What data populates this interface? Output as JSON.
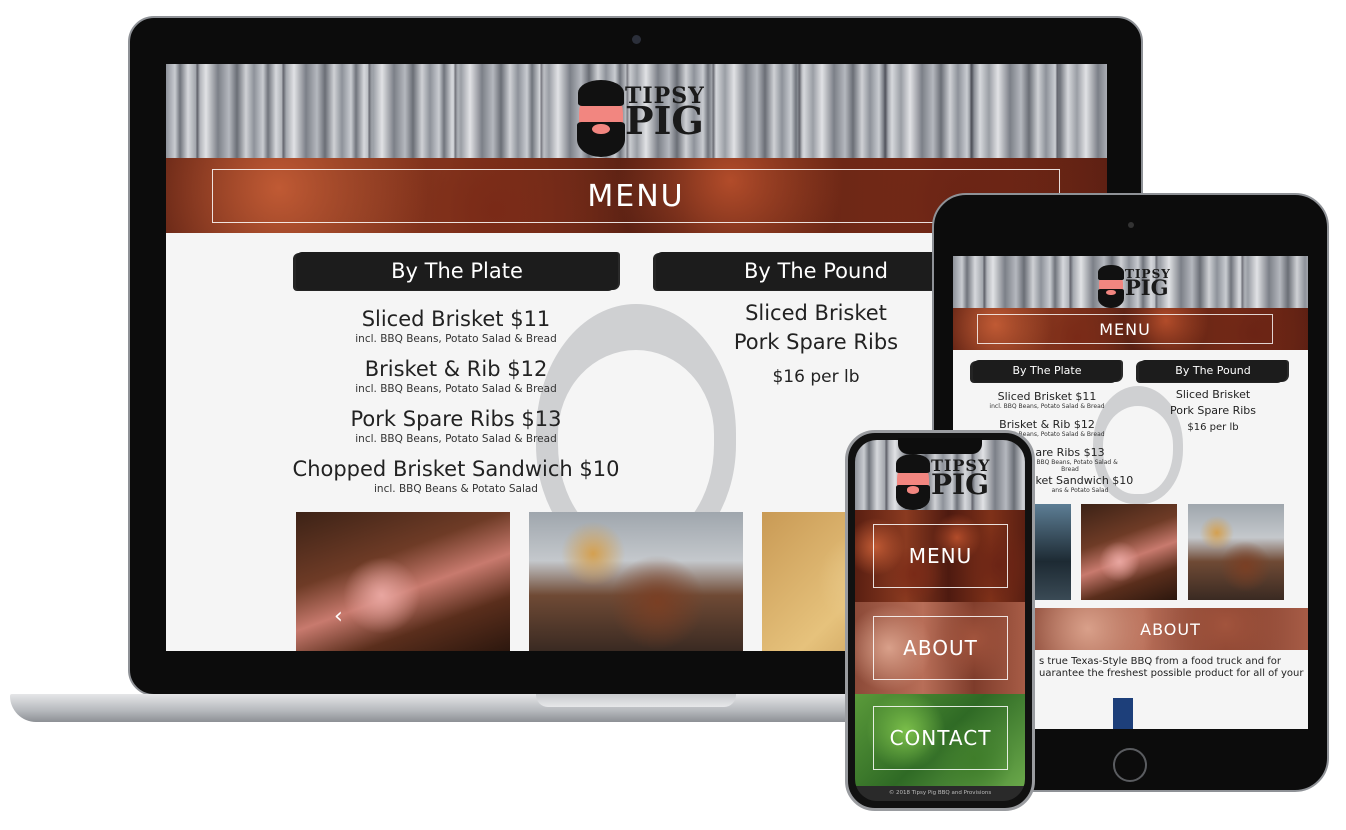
{
  "brand": {
    "name_line1": "TIPSY",
    "name_line2": "PIG"
  },
  "laptop": {
    "banner_title": "MENU",
    "by_plate": {
      "heading": "By The Plate",
      "items": [
        {
          "name": "Sliced Brisket $11",
          "desc": "incl. BBQ Beans, Potato Salad & Bread"
        },
        {
          "name": "Brisket & Rib $12",
          "desc": "incl. BBQ Beans, Potato Salad & Bread"
        },
        {
          "name": "Pork Spare Ribs $13",
          "desc": "incl. BBQ Beans, Potato Salad & Bread"
        },
        {
          "name": "Chopped Brisket Sandwich $10",
          "desc": "incl. BBQ Beans & Potato Salad"
        }
      ]
    },
    "by_pound": {
      "heading": "By The Pound",
      "items": [
        "Sliced Brisket",
        "Pork Spare Ribs"
      ],
      "price": "$16 per lb"
    },
    "carousel_prev": "‹"
  },
  "tablet": {
    "banner_title": "MENU",
    "by_plate": {
      "heading": "By The Plate",
      "items": [
        {
          "name": "Sliced Brisket $11",
          "desc": "incl. BBQ Beans, Potato Salad & Bread"
        },
        {
          "name": "Brisket & Rib $12",
          "desc": "incl. BBQ Beans, Potato Salad & Bread"
        },
        {
          "name": "are Ribs $13",
          "desc": "incl. BBQ Beans, Potato Salad & Bread"
        },
        {
          "name": "isket Sandwich $10",
          "desc": "ans & Potato Salad"
        }
      ]
    },
    "by_pound": {
      "heading": "By The Pound",
      "items": [
        "Sliced Brisket",
        "Pork Spare Ribs"
      ],
      "price": "$16 per lb"
    },
    "about_title": "ABOUT",
    "about_text_1": "s true Texas-Style BBQ from a food truck and for",
    "about_text_2": "uarantee the freshest possible product for all of your"
  },
  "phone": {
    "tiles": [
      "MENU",
      "ABOUT",
      "CONTACT"
    ],
    "footer": "© 2018 Tipsy Pig BBQ and Provisions"
  },
  "colors": {
    "pig_pink": "#f28680",
    "brush_black": "#1c1c1c",
    "page_bg": "#f5f5f5"
  }
}
